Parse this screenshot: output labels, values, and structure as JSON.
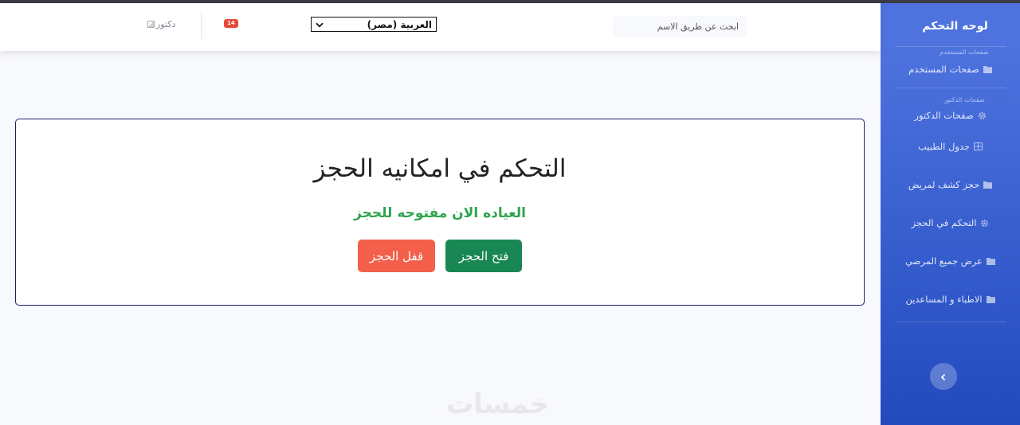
{
  "sidebar": {
    "brand": "لوحه التحكم",
    "sections": [
      {
        "heading": "صفحات المستخدم",
        "items": [
          {
            "label": "صفحات المستخدم",
            "icon": "folder-icon"
          }
        ]
      },
      {
        "heading": "صفحات الدكتور",
        "items": [
          {
            "label": "صفحات الدكتور",
            "icon": "gear-icon"
          },
          {
            "label": "جدول الطبيب",
            "icon": "table-icon"
          },
          {
            "label": "حجز كشف لمريض",
            "icon": "folder-icon"
          },
          {
            "label": "التحكم في الحجز",
            "icon": "gear-icon"
          },
          {
            "label": "عرض جميع المرضي",
            "icon": "folder-icon"
          },
          {
            "label": "الاطباء و المساعدين",
            "icon": "folder-icon"
          }
        ]
      }
    ]
  },
  "topbar": {
    "search_placeholder": "ابحث عن طريق الاسم",
    "language": "العربية (مصر)",
    "notifications_count": "14",
    "user_image_alt": "دكتور"
  },
  "main": {
    "title": "التحكم في امكانيه الحجز",
    "status": "العياده الان مفتوحه للحجز",
    "open_button": "فتح الحجز",
    "close_button": "قفل الحجز"
  },
  "watermark": "خمسات",
  "colors": {
    "sidebar_top": "#4e73df",
    "sidebar_bottom": "#224abe",
    "open_button": "#198754",
    "close_button": "#f45f4b",
    "status_text": "#2ea44f",
    "badge": "#e74a3b"
  }
}
